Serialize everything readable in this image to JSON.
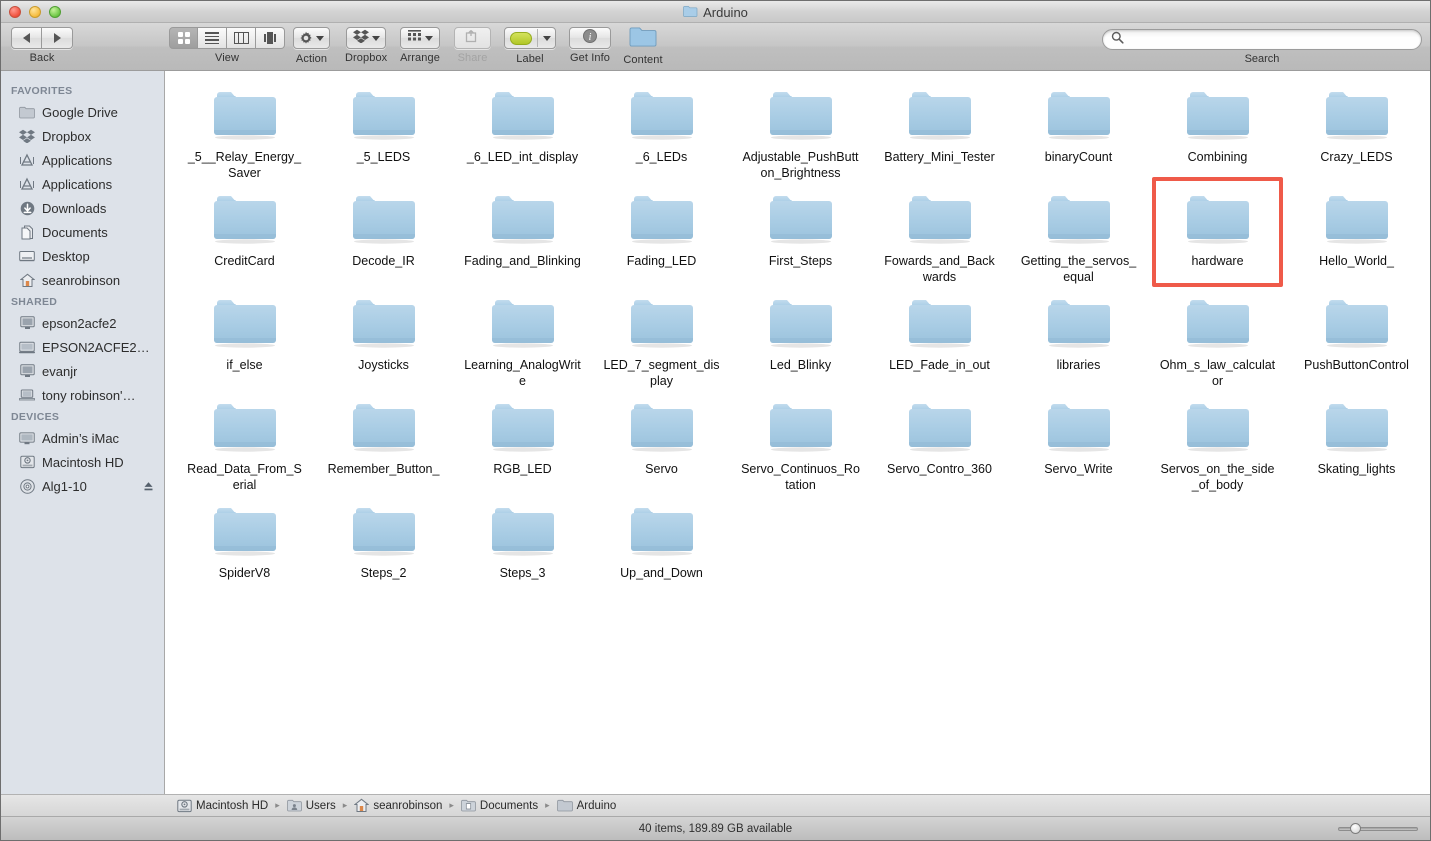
{
  "window": {
    "title": "Arduino",
    "title_icon": "folder-icon"
  },
  "toolbar": {
    "back_label": "Back",
    "view_label": "View",
    "action_label": "Action",
    "dropbox_label": "Dropbox",
    "arrange_label": "Arrange",
    "share_label": "Share",
    "label_label": "Label",
    "getinfo_label": "Get Info",
    "content_label": "Content",
    "label_swatch_color": "#c0d23f",
    "view_modes": [
      "icon-view",
      "list-view",
      "column-view",
      "coverflow-view"
    ],
    "view_selected": "icon-view"
  },
  "search": {
    "value": "",
    "placeholder": "",
    "caption": "Search"
  },
  "sidebar": {
    "sections": [
      {
        "header": "FAVORITES",
        "items": [
          {
            "label": "Google Drive",
            "icon": "folder-icon"
          },
          {
            "label": "Dropbox",
            "icon": "dropbox-icon"
          },
          {
            "label": "Applications",
            "icon": "applications-icon"
          },
          {
            "label": "Applications",
            "icon": "applications-icon"
          },
          {
            "label": "Downloads",
            "icon": "downloads-icon"
          },
          {
            "label": "Documents",
            "icon": "documents-icon"
          },
          {
            "label": "Desktop",
            "icon": "desktop-icon"
          },
          {
            "label": "seanrobinson",
            "icon": "home-icon"
          }
        ]
      },
      {
        "header": "SHARED",
        "items": [
          {
            "label": "epson2acfe2",
            "icon": "display-icon"
          },
          {
            "label": "EPSON2ACFE2…",
            "icon": "monitor-icon"
          },
          {
            "label": "evanjr",
            "icon": "display-icon"
          },
          {
            "label": "tony robinson'…",
            "icon": "laptop-icon"
          }
        ]
      },
      {
        "header": "DEVICES",
        "items": [
          {
            "label": "Admin’s iMac",
            "icon": "imac-icon"
          },
          {
            "label": "Macintosh HD",
            "icon": "harddisk-icon"
          },
          {
            "label": "Alg1-10",
            "icon": "disc-icon",
            "eject": true
          }
        ]
      }
    ]
  },
  "files": {
    "items": [
      "_5__Relay_Energy_Saver",
      "_5_LEDS",
      "_6_LED_int_display",
      "_6_LEDs",
      "Adjustable_PushButton_Brightness",
      "Battery_Mini_Tester",
      "binaryCount",
      "Combining",
      "Crazy_LEDS",
      "CreditCard",
      "Decode_IR",
      "Fading_and_Blinking",
      "Fading_LED",
      "First_Steps",
      "Fowards_and_Backwards",
      "Getting_the_servos_equal",
      "hardware",
      "Hello_World_",
      "if_else",
      "Joysticks",
      "Learning_AnalogWrite",
      "LED_7_segment_display",
      "Led_Blinky",
      "LED_Fade_in_out",
      "libraries",
      "Ohm_s_law_calculator",
      "PushButtonControl",
      "Read_Data_From_Serial",
      "Remember_Button_",
      "RGB_LED",
      "Servo",
      "Servo_Continuos_Rotation",
      "Servo_Contro_360",
      "Servo_Write",
      "Servos_on_the_side_of_body",
      "Skating_lights",
      "SpiderV8",
      "Steps_2",
      "Steps_3",
      "Up_and_Down"
    ],
    "highlighted": "hardware",
    "highlight_color": "#ef5a49"
  },
  "pathbar": {
    "crumbs": [
      {
        "label": "Macintosh HD",
        "icon": "harddisk-icon"
      },
      {
        "label": "Users",
        "icon": "users-folder-icon"
      },
      {
        "label": "seanrobinson",
        "icon": "home-icon"
      },
      {
        "label": "Documents",
        "icon": "documents-folder-icon"
      },
      {
        "label": "Arduino",
        "icon": "folder-icon"
      }
    ],
    "separator": "▸"
  },
  "statusbar": {
    "text": "40 items, 189.89 GB available",
    "zoom_slider_value": 15
  }
}
